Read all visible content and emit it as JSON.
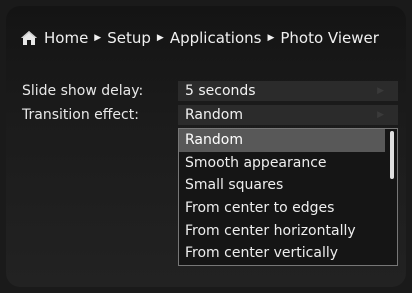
{
  "breadcrumb": {
    "home": "Home",
    "setup": "Setup",
    "applications": "Applications",
    "photo_viewer": "Photo Viewer",
    "separator_icon": "triangle-right-icon",
    "home_icon": "house-icon"
  },
  "settings": {
    "slide_show_delay": {
      "label": "Slide show delay:",
      "value": "5 seconds"
    },
    "transition_effect": {
      "label": "Transition effect:",
      "value": "Random"
    }
  },
  "dropdown": {
    "options": [
      "Random",
      "Smooth appearance",
      "Small squares",
      "From center to edges",
      "From center horizontally",
      "From center vertically"
    ],
    "selected_index": 0
  },
  "colors": {
    "background": "#1b1b1b",
    "field": "#2b2b2b",
    "highlight": "#585858",
    "text": "#e8e8e8"
  }
}
